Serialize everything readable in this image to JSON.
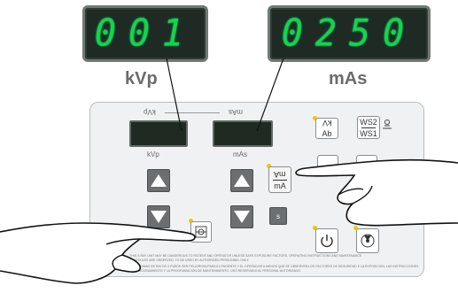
{
  "displays": {
    "kvp_value": "001",
    "mas_value": "0250",
    "kvp_label": "kVp",
    "mas_label": "mAs"
  },
  "panel": {
    "kvp_small_label": "kVp",
    "mas_small_label": "mAs",
    "kvp_top_label_flipped": "kVp",
    "mas_top_label_flipped": "mAs",
    "kv_ab_top": "kV",
    "kv_ab_bottom": "Ab",
    "ws_top": "WS2",
    "ws_bottom": "WS1",
    "mas_ma_top": "mA",
    "mas_ma_bottom": "mA",
    "s_label": "s",
    "fine_print_1": "THIS X-RAY UNIT MAY BE DANGEROUS TO PATIENT AND OPERATOR UNLESS SAFE EXPOSURE FACTORS, OPERATING INSTRUCTIONS AND MAINTENANCE",
    "fine_print_2": "SCHEDULES ARE OBSERVED. TO BE USED BY AUTHORIZED PERSONNEL ONLY.",
    "fine_print_3": "ESTA UNIDAD DE RAYOS X PUEDE SER PELIGROSA PARA EL PACIENTE Y EL OPERADOR A MENOS QUE SE OBSERVEN LOS FACTORES DE SEGURIDAD E LA EXPOSICION, LAS INSTRUCCIONES",
    "fine_print_4": "DE FUNCIONAMIENTO Y LA PROGRAMACION DE MANTENIMIENTO. USO RESERVADO AL PERSONAL AUTORIZADO."
  },
  "colors": {
    "led_digit": "#16d44a",
    "led_bg": "#1e2a23",
    "button_gray": "#6b6f72",
    "indicator_yellow": "#f2c500"
  }
}
